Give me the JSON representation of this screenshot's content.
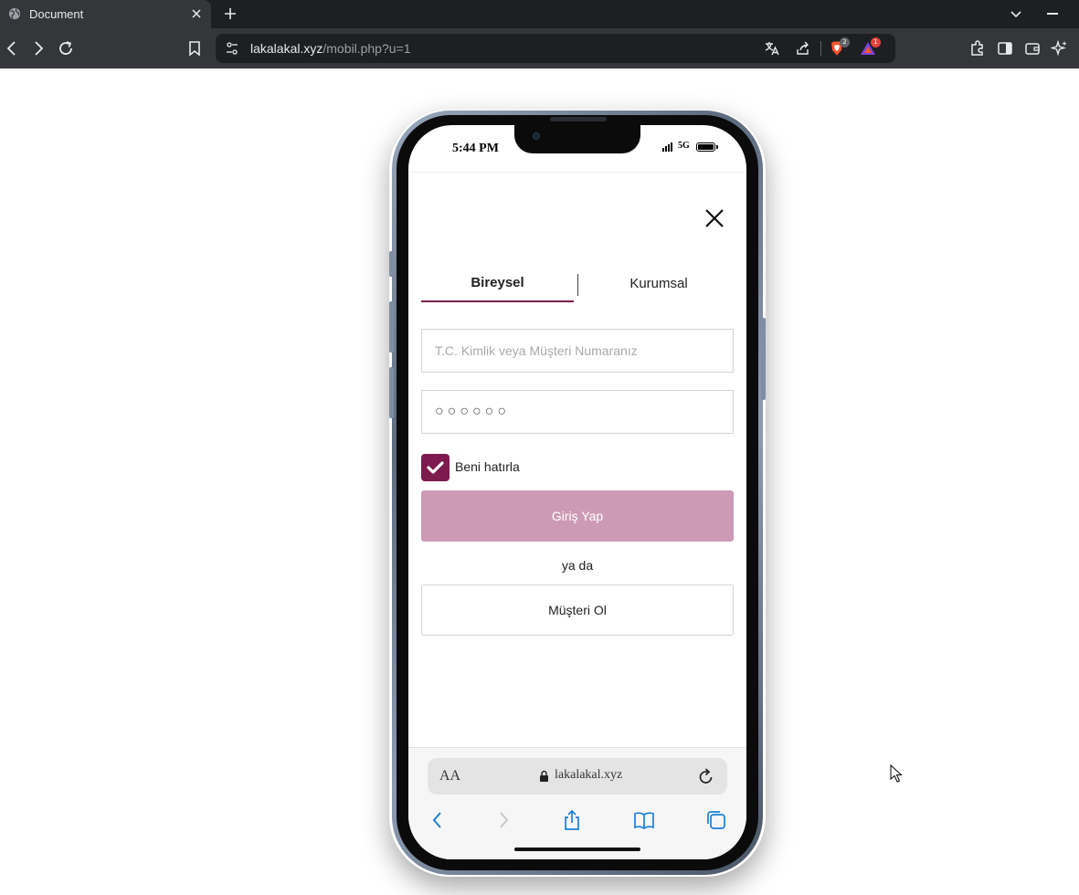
{
  "browser": {
    "tab_title": "Document",
    "url_host": "lakalakal.xyz",
    "url_path": "/mobil.php?u=1",
    "brave_badge": "2",
    "rewards_badge": "1",
    "icons": [
      "globe-icon",
      "close-icon",
      "plus-icon",
      "chevron-down-icon",
      "minimize-icon",
      "back-arrow-icon",
      "forward-arrow-icon",
      "reload-icon",
      "bookmark-icon",
      "site-settings-icon",
      "translate-icon",
      "share-icon",
      "brave-shield-icon",
      "brave-rewards-icon",
      "extensions-icon",
      "sidebar-icon",
      "wallet-icon",
      "leo-ai-icon"
    ]
  },
  "phone": {
    "status": {
      "time": "5:44 PM",
      "network": "5G"
    },
    "tabs": {
      "individual": "Bireysel",
      "corporate": "Kurumsal"
    },
    "form": {
      "id_placeholder": "T.C. Kimlik veya Müşteri Numaranız",
      "password_value": "○○○○○○",
      "remember_label": "Beni hatırla",
      "remember_checked": true,
      "login_label": "Giriş Yap",
      "or_label": "ya da",
      "signup_label": "Müşteri Ol"
    },
    "safari": {
      "aa_label": "AA",
      "host": "lakalakal.xyz"
    }
  },
  "colors": {
    "accent": "#7d1a4e",
    "login_button": "#cd9ab6",
    "ios_blue": "#1a7fd9"
  }
}
